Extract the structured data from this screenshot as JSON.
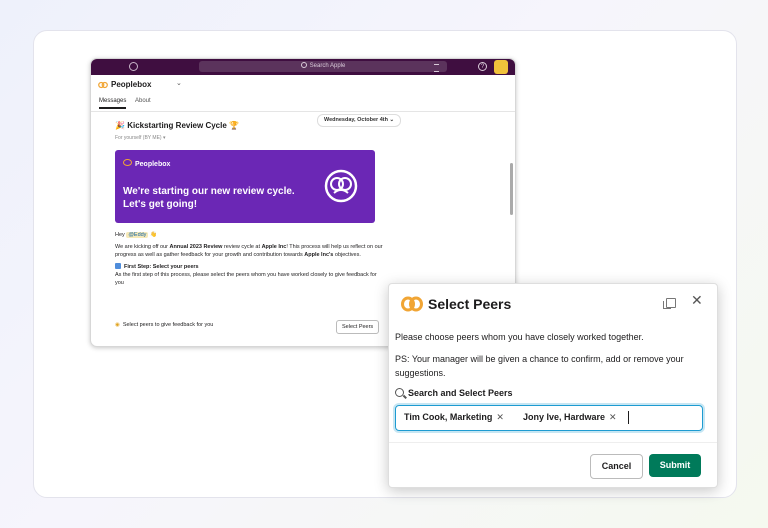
{
  "slack": {
    "search_placeholder": "Search Apple",
    "help_label": "?",
    "channel_name": "Peoplebox",
    "tabs": [
      {
        "label": "Messages"
      },
      {
        "label": "About"
      }
    ],
    "date_label": "Wednesday, October 4th",
    "message": {
      "title": "Kickstarting Review Cycle",
      "sub": "For yourself (BY ME) ▾",
      "banner_brand": "Peoplebox",
      "banner_line1": "We're starting our new review cycle.",
      "banner_line2": "Let's get going!",
      "greeting": "Hey",
      "mention": "@Eddy",
      "para_pre": "We are kicking off our",
      "para_bold1": "Annual 2023 Review",
      "para_mid": "review cycle at",
      "para_bold2": "Apple Inc",
      "para_rest": "! This process will help us reflect on our progress as well as gather feedback for your growth and contribution towards",
      "para_bold3": "Apple Inc's",
      "para_end": "objectives.",
      "step_title": "First Step: Select your peers",
      "step_text": "As the first step of this process, please select the peers whom you have worked closely to give feedback for you",
      "footer_text": "Select peers to give feedback for you",
      "select_button": "Select Peers"
    }
  },
  "modal": {
    "title": "Select Peers",
    "line1": "Please choose peers whom you have closely worked together.",
    "line2": "PS: Your manager will be given a chance to confirm, add or remove your suggestions.",
    "search_label": "Search and Select Peers",
    "chips": [
      {
        "label": "Tim Cook, Marketing"
      },
      {
        "label": "Jony Ive, Hardware"
      }
    ],
    "cancel_label": "Cancel",
    "submit_label": "Submit"
  },
  "colors": {
    "slack_topbar": "#3f0e40",
    "banner": "#6b27b5",
    "brand_orange": "#f1a534",
    "submit_green": "#007a5a",
    "input_focus": "#1d9bd1"
  },
  "icons": [
    "history-icon",
    "search-icon",
    "filter-icon",
    "help-icon",
    "peoplebox-logo-icon",
    "pretzel-icon",
    "copy-icon",
    "close-icon",
    "remove-chip-icon"
  ]
}
